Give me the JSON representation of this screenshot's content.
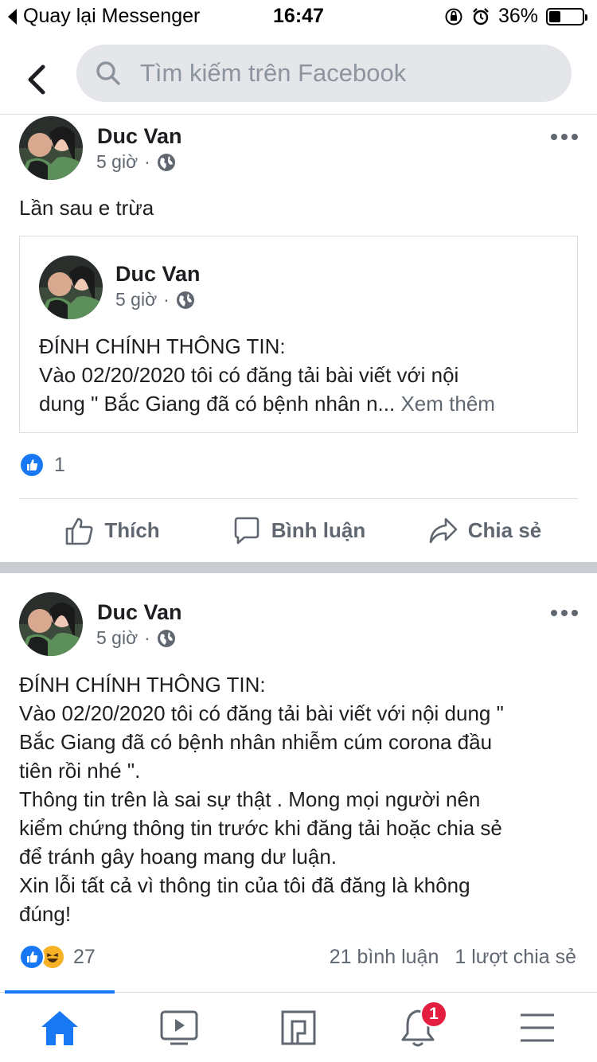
{
  "status_bar": {
    "back_label": "Quay lại Messenger",
    "time": "16:47",
    "battery": "36%",
    "battery_level": 0.36
  },
  "header": {
    "search_placeholder": "Tìm kiếm trên Facebook"
  },
  "post1": {
    "author": "Duc Van",
    "time": "5 giờ",
    "text": "Lần sau e trừa",
    "shared": {
      "author": "Duc Van",
      "time": "5 giờ",
      "line1": "ĐÍNH CHÍNH THÔNG TIN:",
      "line2": "Vào 02/20/2020 tôi có đăng tải bài viết với nội",
      "line3": "dung \" Bắc Giang đã có bệnh nhân n...",
      "see_more": "Xem thêm"
    },
    "reaction_count": "1",
    "actions": {
      "like": "Thích",
      "comment": "Bình luận",
      "share": "Chia sẻ"
    }
  },
  "post2": {
    "author": "Duc Van",
    "time": "5 giờ",
    "lines": [
      "ĐÍNH CHÍNH THÔNG TIN:",
      "Vào 02/20/2020 tôi có đăng tải bài viết với nội dung \"",
      "Bắc Giang đã có bệnh nhân nhiễm cúm corona đầu",
      "tiên rồi nhé \".",
      "Thông tin trên là sai sự thật .  Mong mọi người nên",
      "kiểm chứng thông tin trước khi đăng tải hoặc chia sẻ",
      "để tránh gây hoang mang dư luận.",
      "Xin lỗi tất cả vì thông tin của tôi đã đăng là không",
      "đúng!"
    ],
    "reaction_count": "27",
    "comments": "21 bình luận",
    "shares": "1 lượt chia sẻ"
  },
  "bottom_nav": {
    "notification_badge": "1",
    "accent": "#1877f2"
  }
}
